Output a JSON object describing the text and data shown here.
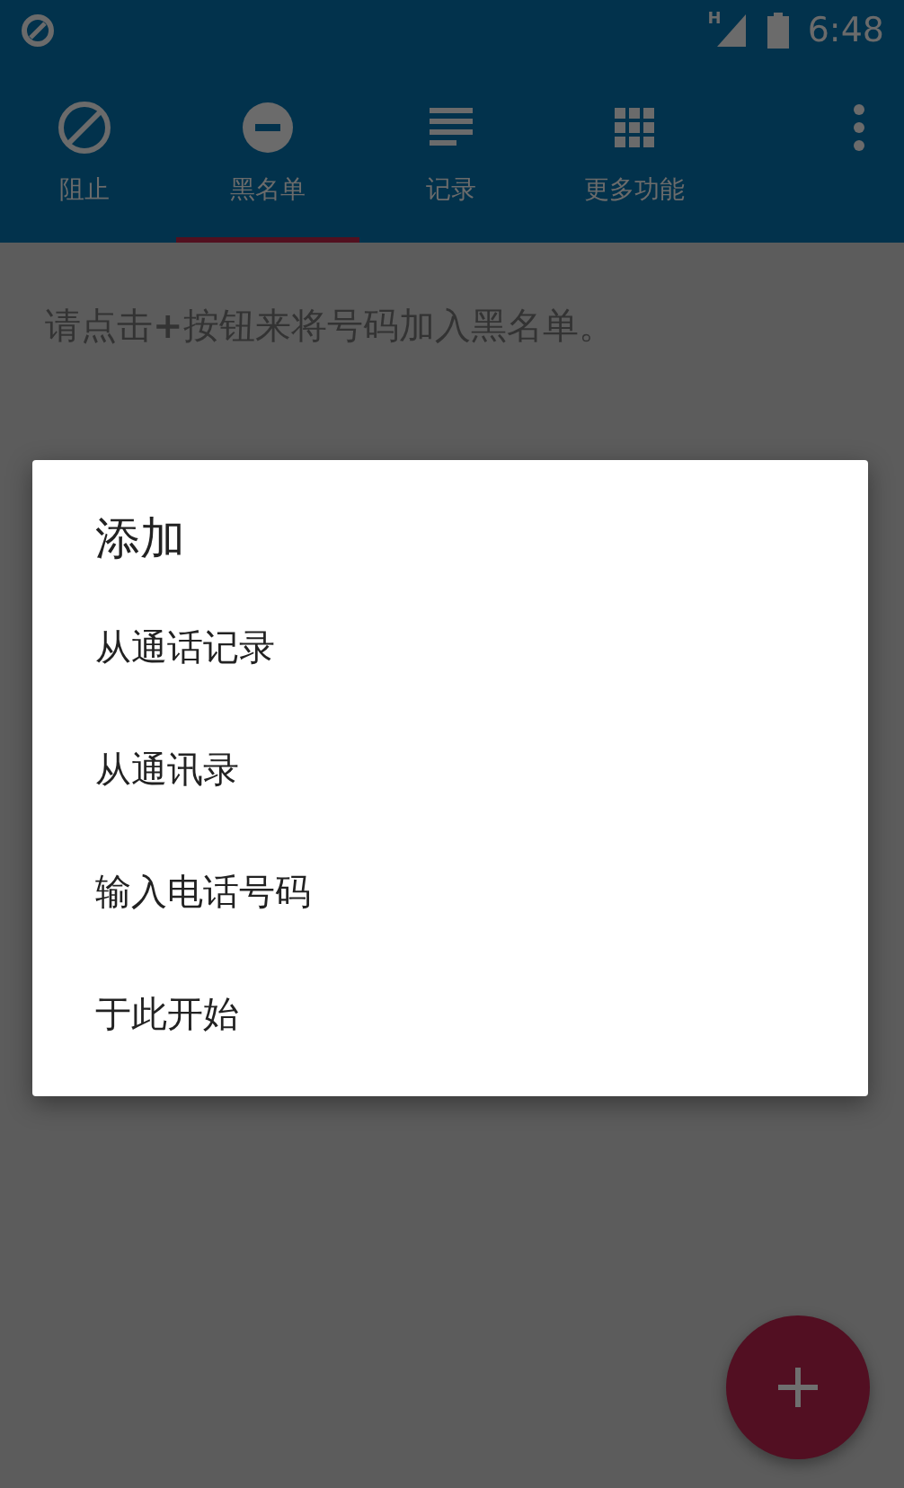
{
  "status_bar": {
    "network_type": "H",
    "time": "6:48"
  },
  "tabs": [
    {
      "label": "阻止",
      "kind": "block",
      "selected": false
    },
    {
      "label": "黑名单",
      "kind": "minus",
      "selected": true
    },
    {
      "label": "记录",
      "kind": "list",
      "selected": false
    },
    {
      "label": "更多功能",
      "kind": "grid",
      "selected": false
    }
  ],
  "hint": "请点击**+**按钮来将号码加入黑名单。",
  "dialog": {
    "title": "添加",
    "items": [
      "从通话记录",
      "从通讯录",
      "输入电话号码",
      "于此开始"
    ]
  }
}
